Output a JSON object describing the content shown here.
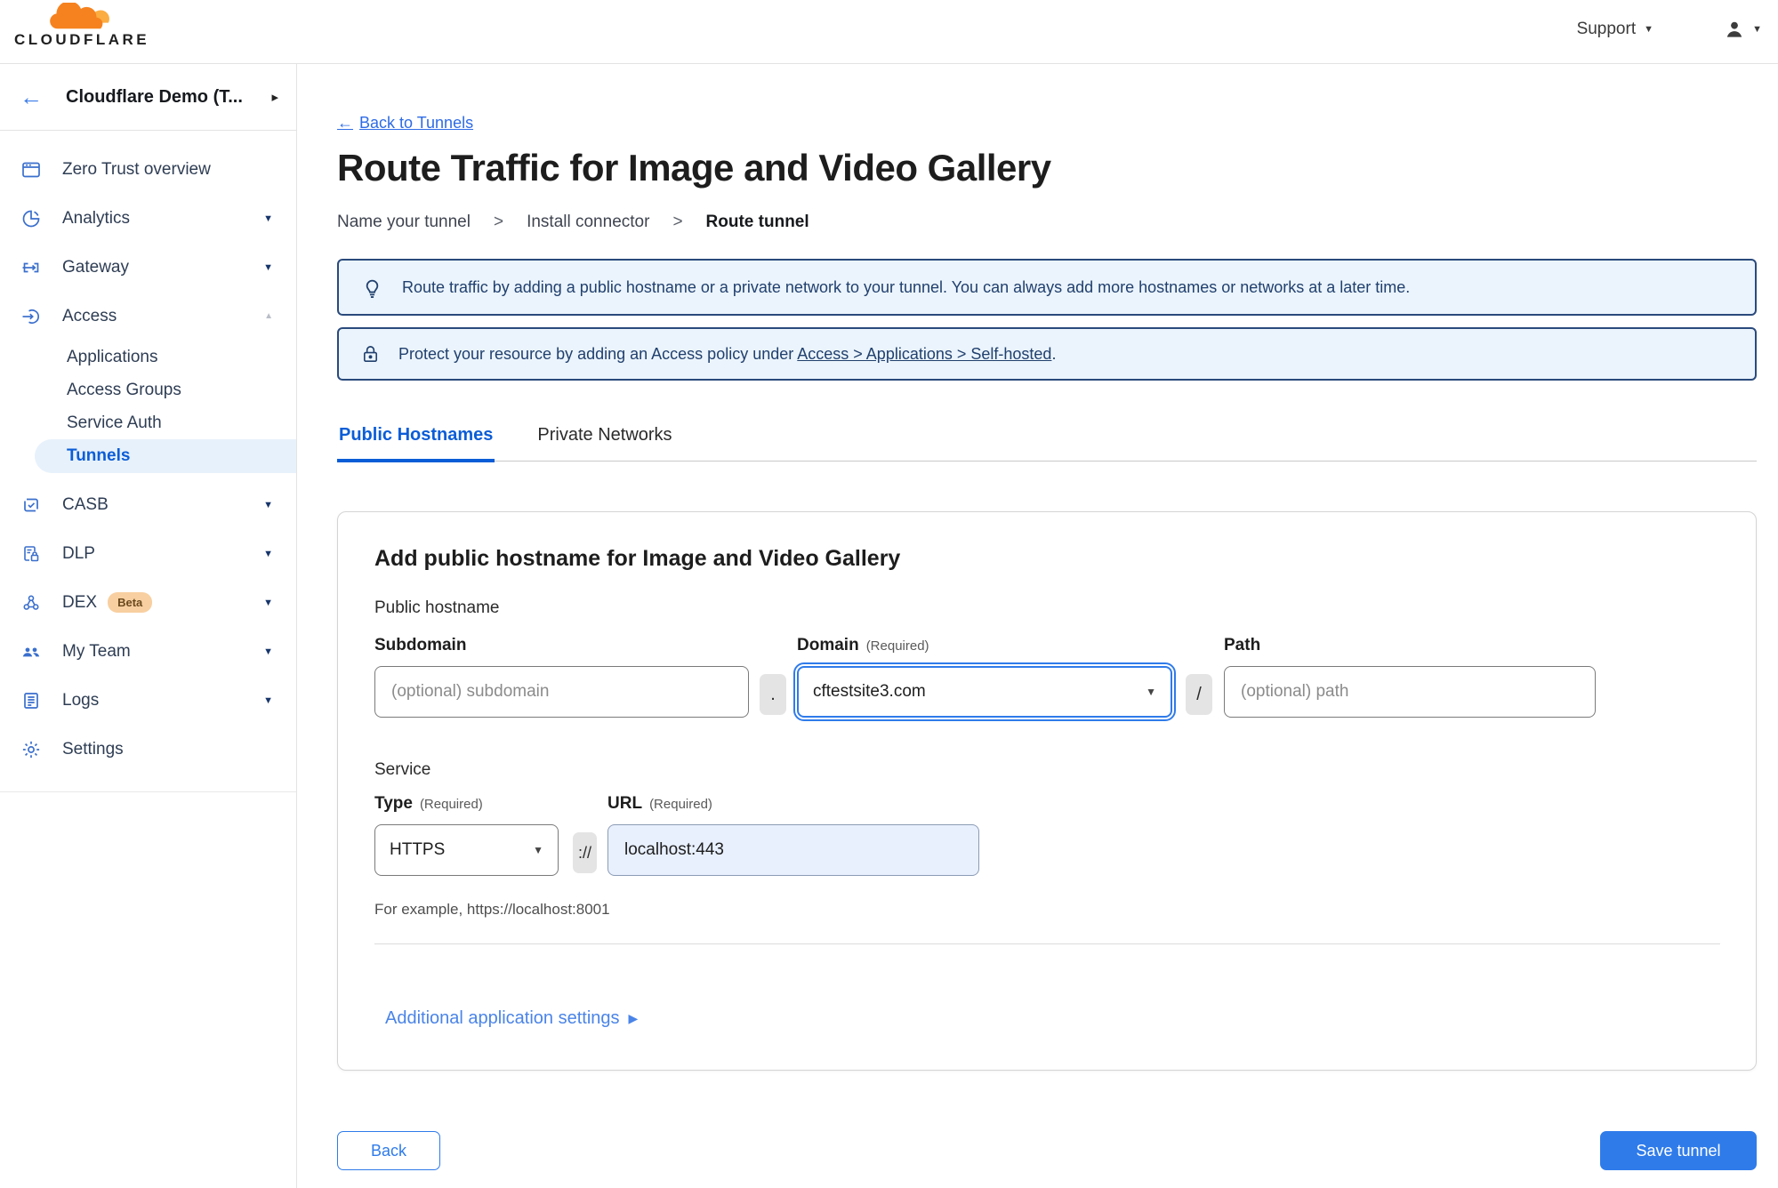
{
  "topbar": {
    "brand": "CLOUDFLARE",
    "support_label": "Support"
  },
  "icons": {
    "back_arrow": "←",
    "chevron_down": "▼",
    "chevron_up": "▲",
    "chevron_right_small": "▸",
    "caret_down": "▼",
    "arrow_right": "▶"
  },
  "sidebar": {
    "account_name": "Cloudflare Demo (T...",
    "items": [
      {
        "label": "Zero Trust overview"
      },
      {
        "label": "Analytics"
      },
      {
        "label": "Gateway"
      },
      {
        "label": "Access"
      },
      {
        "label": "CASB"
      },
      {
        "label": "DLP"
      },
      {
        "label": "DEX",
        "badge": "Beta"
      },
      {
        "label": "My Team"
      },
      {
        "label": "Logs"
      },
      {
        "label": "Settings"
      }
    ],
    "access_children": [
      {
        "label": "Applications"
      },
      {
        "label": "Access Groups"
      },
      {
        "label": "Service Auth"
      },
      {
        "label": "Tunnels"
      }
    ]
  },
  "page": {
    "back_link": "Back to Tunnels",
    "title": "Route Traffic for Image and Video Gallery",
    "steps": {
      "separator": ">",
      "items": [
        "Name your tunnel",
        "Install connector",
        "Route tunnel"
      ]
    },
    "banners": [
      {
        "text": "Route traffic by adding a public hostname or a private network to your tunnel. You can always add more hostnames or networks at a later time."
      },
      {
        "text_prefix": "Protect your resource by adding an Access policy under ",
        "link_text": "Access > Applications > Self-hosted",
        "text_suffix": "."
      }
    ],
    "tabs": [
      {
        "label": "Public Hostnames"
      },
      {
        "label": "Private Networks"
      }
    ]
  },
  "form": {
    "heading": "Add public hostname for Image and Video Gallery",
    "public_hostname_label": "Public hostname",
    "required_note": "(Required)",
    "subdomain": {
      "label": "Subdomain",
      "placeholder": "(optional) subdomain"
    },
    "dot_separator": ".",
    "domain": {
      "label": "Domain",
      "value": "cftestsite3.com"
    },
    "slash_separator": "/",
    "path": {
      "label": "Path",
      "placeholder": "(optional) path"
    },
    "service_label": "Service",
    "type": {
      "label": "Type",
      "value": "HTTPS"
    },
    "scheme_separator": "://",
    "url": {
      "label": "URL",
      "value": "localhost:443"
    },
    "example_hint": "For example, https://localhost:8001",
    "settings_link": "Additional application settings"
  },
  "footer": {
    "back_label": "Back",
    "save_label": "Save tunnel"
  },
  "colors": {
    "accent_blue": "#2f7bea",
    "tab_active_blue": "#0b5dd7",
    "sidebar_icon_blue": "#3a6fcd",
    "banner_bg": "#ebf4fc",
    "banner_border": "#2a4a7c",
    "banner_text": "#21406e",
    "tunnels_pill_bg": "#e7f1fb",
    "beta_badge_bg": "#f8cfa0",
    "url_autofill_bg": "#e8f0fe",
    "logo_orange": "#f6821f",
    "logo_light_orange": "#fbad41"
  }
}
